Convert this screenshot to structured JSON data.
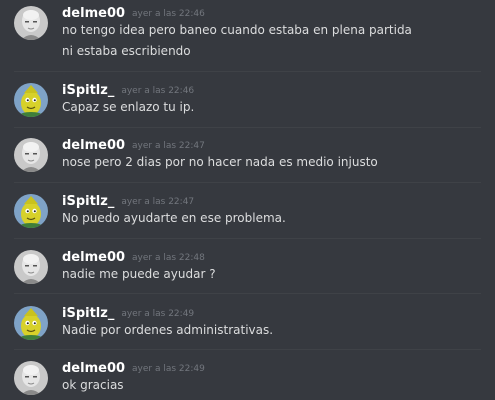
{
  "messages": [
    {
      "author": "delme00",
      "avatar": "bald-man-avatar",
      "time": "ayer a las 22:46",
      "lines": [
        "no tengo idea pero baneo cuando estaba en plena partida",
        "ni estaba escribiendo"
      ]
    },
    {
      "author": "iSpitlz_",
      "avatar": "yellow-cartoon-avatar",
      "time": "ayer a las 22:46",
      "lines": [
        "Capaz se enlazo tu ip."
      ]
    },
    {
      "author": "delme00",
      "avatar": "bald-man-avatar",
      "time": "ayer a las 22:47",
      "lines": [
        "nose pero 2 dias por no hacer nada es medio injusto"
      ]
    },
    {
      "author": "iSpitlz_",
      "avatar": "yellow-cartoon-avatar",
      "time": "ayer a las 22:47",
      "lines": [
        "No puedo ayudarte en ese problema."
      ]
    },
    {
      "author": "delme00",
      "avatar": "bald-man-avatar",
      "time": "ayer a las 22:48",
      "lines": [
        "nadie me puede ayudar ?"
      ]
    },
    {
      "author": "iSpitlz_",
      "avatar": "yellow-cartoon-avatar",
      "time": "ayer a las 22:49",
      "lines": [
        "Nadie por ordenes administrativas."
      ]
    },
    {
      "author": "delme00",
      "avatar": "bald-man-avatar",
      "time": "ayer a las 22:49",
      "lines": [
        "ok gracias"
      ]
    }
  ],
  "colors": {
    "background": "#36393f",
    "username": "#ffffff",
    "timestamp": "#72767d",
    "message_text": "#dcddde",
    "divider": "#3f4247"
  }
}
